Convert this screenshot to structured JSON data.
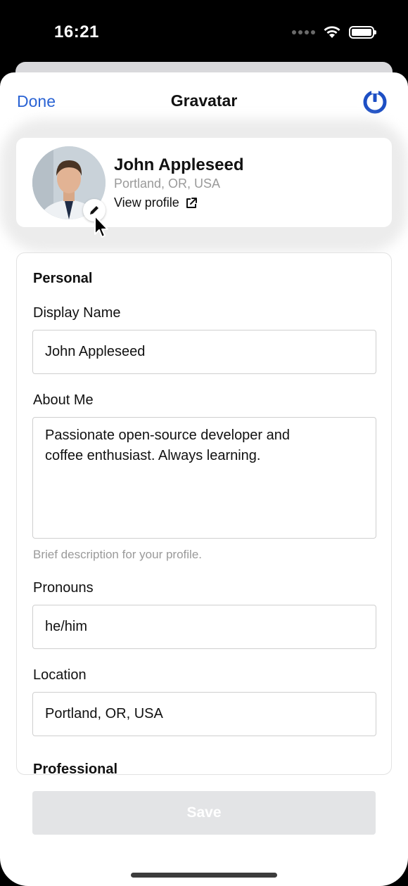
{
  "status_bar": {
    "time": "16:21"
  },
  "nav": {
    "done_label": "Done",
    "title": "Gravatar"
  },
  "profile": {
    "name": "John Appleseed",
    "location": "Portland, OR, USA",
    "view_profile_label": "View profile"
  },
  "form": {
    "personal_section": "Personal",
    "display_name_label": "Display Name",
    "display_name_value": "John Appleseed",
    "about_label": "About Me",
    "about_line1": "Passionate open-source developer and",
    "about_line2": "coffee enthusiast. Always learning.",
    "about_hint": "Brief description for your profile.",
    "pronouns_label": "Pronouns",
    "pronouns_value": "he/him",
    "location_label": "Location",
    "location_value": "Portland, OR, USA",
    "professional_section": "Professional"
  },
  "save_label": "Save",
  "colors": {
    "accent": "#2a63d4",
    "logo": "#1d4fc4",
    "disabled_button": "#e3e4e6"
  }
}
